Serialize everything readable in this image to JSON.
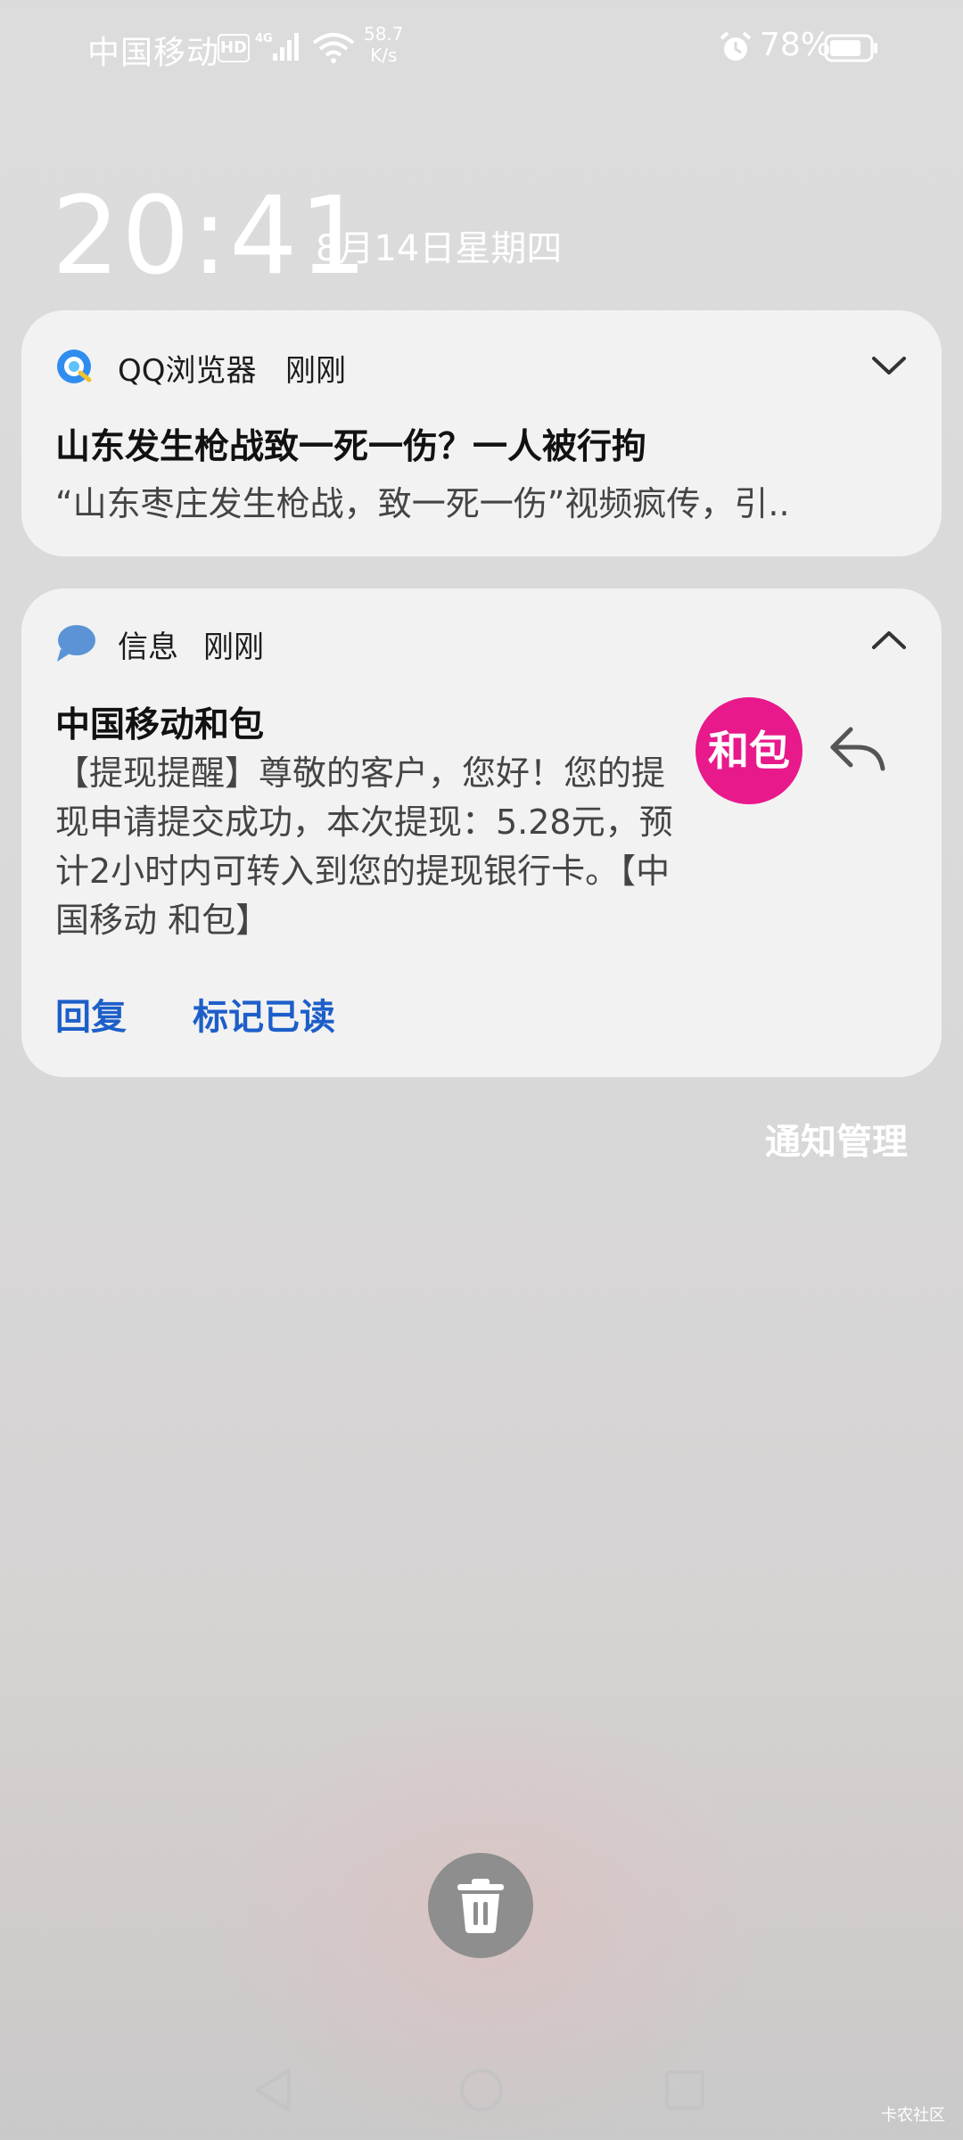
{
  "status_bar": {
    "carrier": "中国移动",
    "hd_badge": "HD",
    "network_type": "4G",
    "net_speed_value": "58.7",
    "net_speed_unit": "K/s",
    "battery": "78%",
    "icons": [
      "hd-icon",
      "signal-icon",
      "wifi-icon",
      "alarm-icon",
      "battery-icon"
    ]
  },
  "lockscreen": {
    "time": "20:41",
    "date": "8月14日星期四"
  },
  "notifications": [
    {
      "app": "QQ浏览器",
      "time": "刚刚",
      "icon": "qq-browser-icon",
      "title": "山东发生枪战致一死一伤？一人被行拘",
      "body": "“山东枣庄发生枪战，致一死一伤”视频疯传，引..",
      "expand_icon": "chevron-down-icon"
    },
    {
      "app": "信息",
      "time": "刚刚",
      "icon": "message-bubble-icon",
      "sender": "中国移动和包",
      "avatar_text": "和包",
      "avatar_color": "#e8198b",
      "body": "【提现提醒】尊敬的客户，您好！您的提现申请提交成功，本次提现：5.28元，预计2小时内可转入到您的提现银行卡。【中国移动 和包】",
      "collapse_icon": "chevron-up-icon",
      "actions": [
        "回复",
        "标记已读"
      ]
    }
  ],
  "notification_management": "通知管理",
  "clear_icon": "trash-icon",
  "navigation": [
    "back-icon",
    "home-icon",
    "recents-icon"
  ],
  "watermark": "卡农社区",
  "colors": {
    "action_blue": "#1d5fc9",
    "card_background": "#f2f2f2"
  }
}
